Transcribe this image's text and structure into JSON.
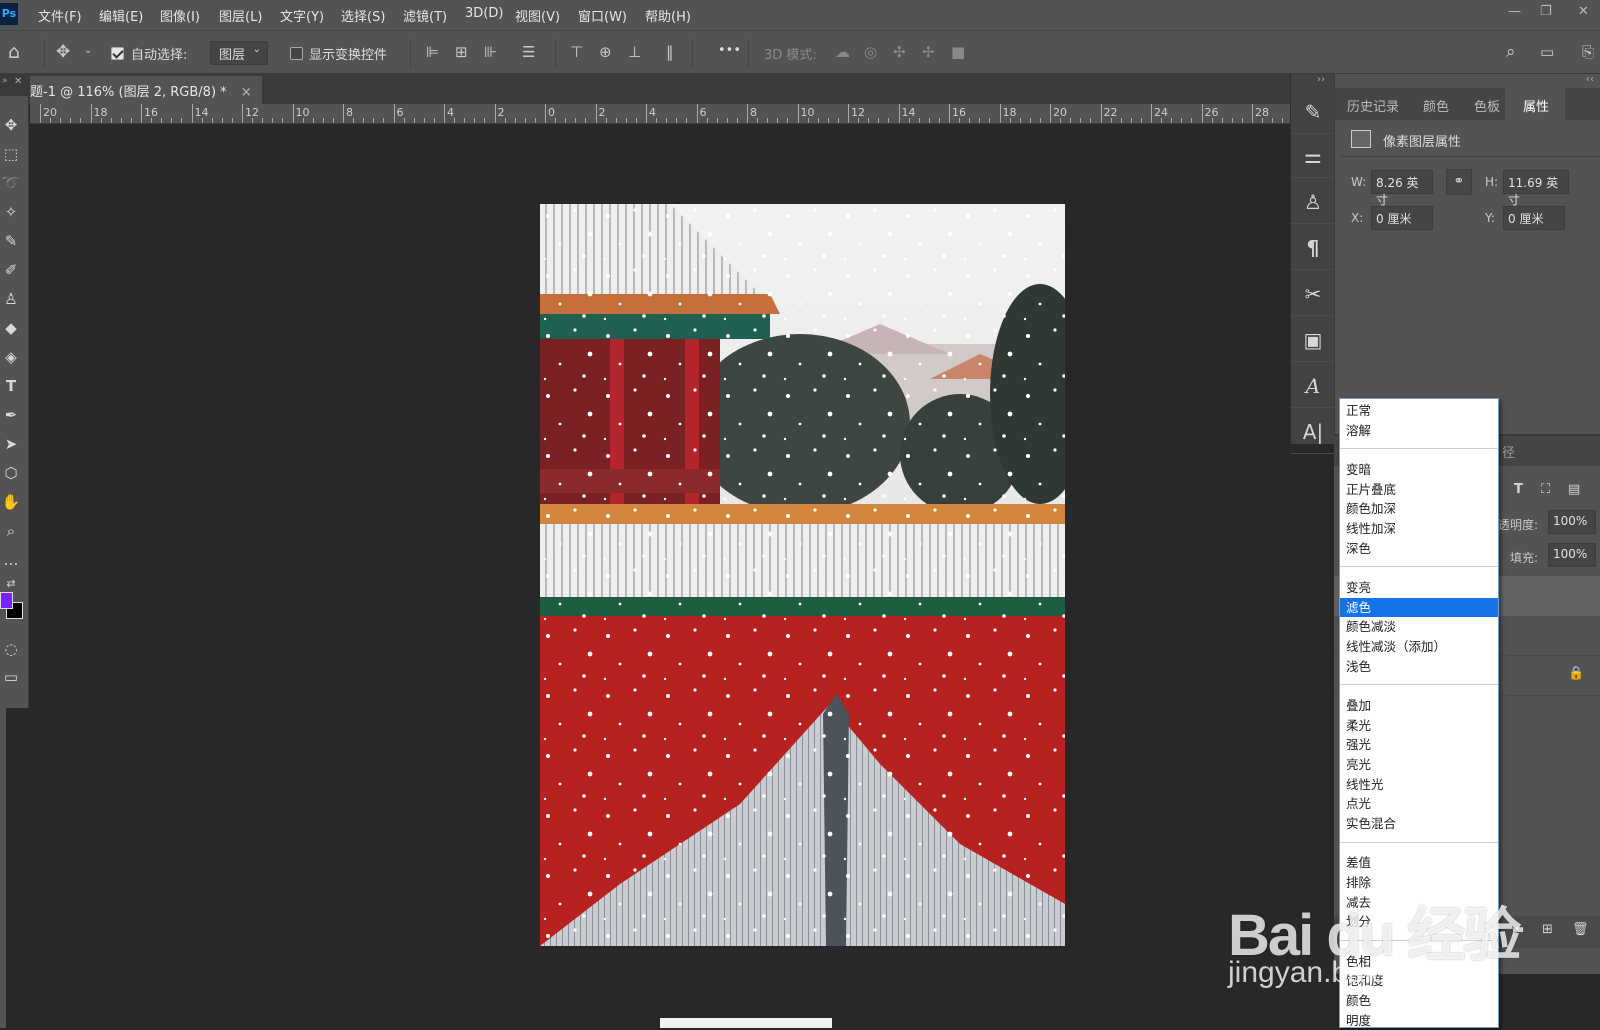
{
  "app": {
    "logo": "Ps"
  },
  "menu": [
    "文件(F)",
    "编辑(E)",
    "图像(I)",
    "图层(L)",
    "文字(Y)",
    "选择(S)",
    "滤镜(T)",
    "3D(D)",
    "视图(V)",
    "窗口(W)",
    "帮助(H)"
  ],
  "options": {
    "auto_select_label": "自动选择:",
    "auto_select_checked": true,
    "auto_select_target": "图层",
    "show_transform_label": "显示变换控件",
    "show_transform_checked": false,
    "mode_3d_label": "3D 模式:",
    "more": "•••"
  },
  "document_tab": {
    "title": "题-1 @ 116% (图层 2, RGB/8) *",
    "close": "×"
  },
  "ruler": {
    "labels": [
      "20",
      "18",
      "16",
      "14",
      "12",
      "10",
      "8",
      "6",
      "4",
      "2",
      "0",
      "2",
      "4",
      "6",
      "8",
      "10",
      "12",
      "14",
      "16",
      "18",
      "20",
      "22",
      "24",
      "26",
      "28"
    ]
  },
  "colors": {
    "foreground": "#7a22ff",
    "background": "#000000",
    "accent": "#1473e6"
  },
  "panel": {
    "tabs": [
      "历史记录",
      "颜色",
      "色板",
      "属性"
    ],
    "active_tab": "属性",
    "section_title": "像素图层属性",
    "w_label": "W:",
    "w_value": "8.26 英寸",
    "h_label": "H:",
    "h_value": "11.69 英寸",
    "x_label": "X:",
    "x_value": "0 厘米",
    "y_label": "Y:",
    "y_value": "0 厘米"
  },
  "layers_partial": {
    "tab_fragment": "径",
    "opacity_label": "透明度:",
    "opacity_value": "100%",
    "fill_label": "填充:",
    "fill_value": "100%"
  },
  "blend_modes": {
    "groups": [
      [
        "正常",
        "溶解"
      ],
      [
        "变暗",
        "正片叠底",
        "颜色加深",
        "线性加深",
        "深色"
      ],
      [
        "变亮",
        "滤色",
        "颜色减淡",
        "线性减淡（添加）",
        "浅色"
      ],
      [
        "叠加",
        "柔光",
        "强光",
        "亮光",
        "线性光",
        "点光",
        "实色混合"
      ],
      [
        "差值",
        "排除",
        "减去",
        "划分"
      ],
      [
        "色相",
        "饱和度",
        "颜色",
        "明度"
      ]
    ],
    "selected": "滤色"
  },
  "watermark": {
    "brand": "Bai du 经验",
    "url": "jingyan.baidu.com"
  }
}
